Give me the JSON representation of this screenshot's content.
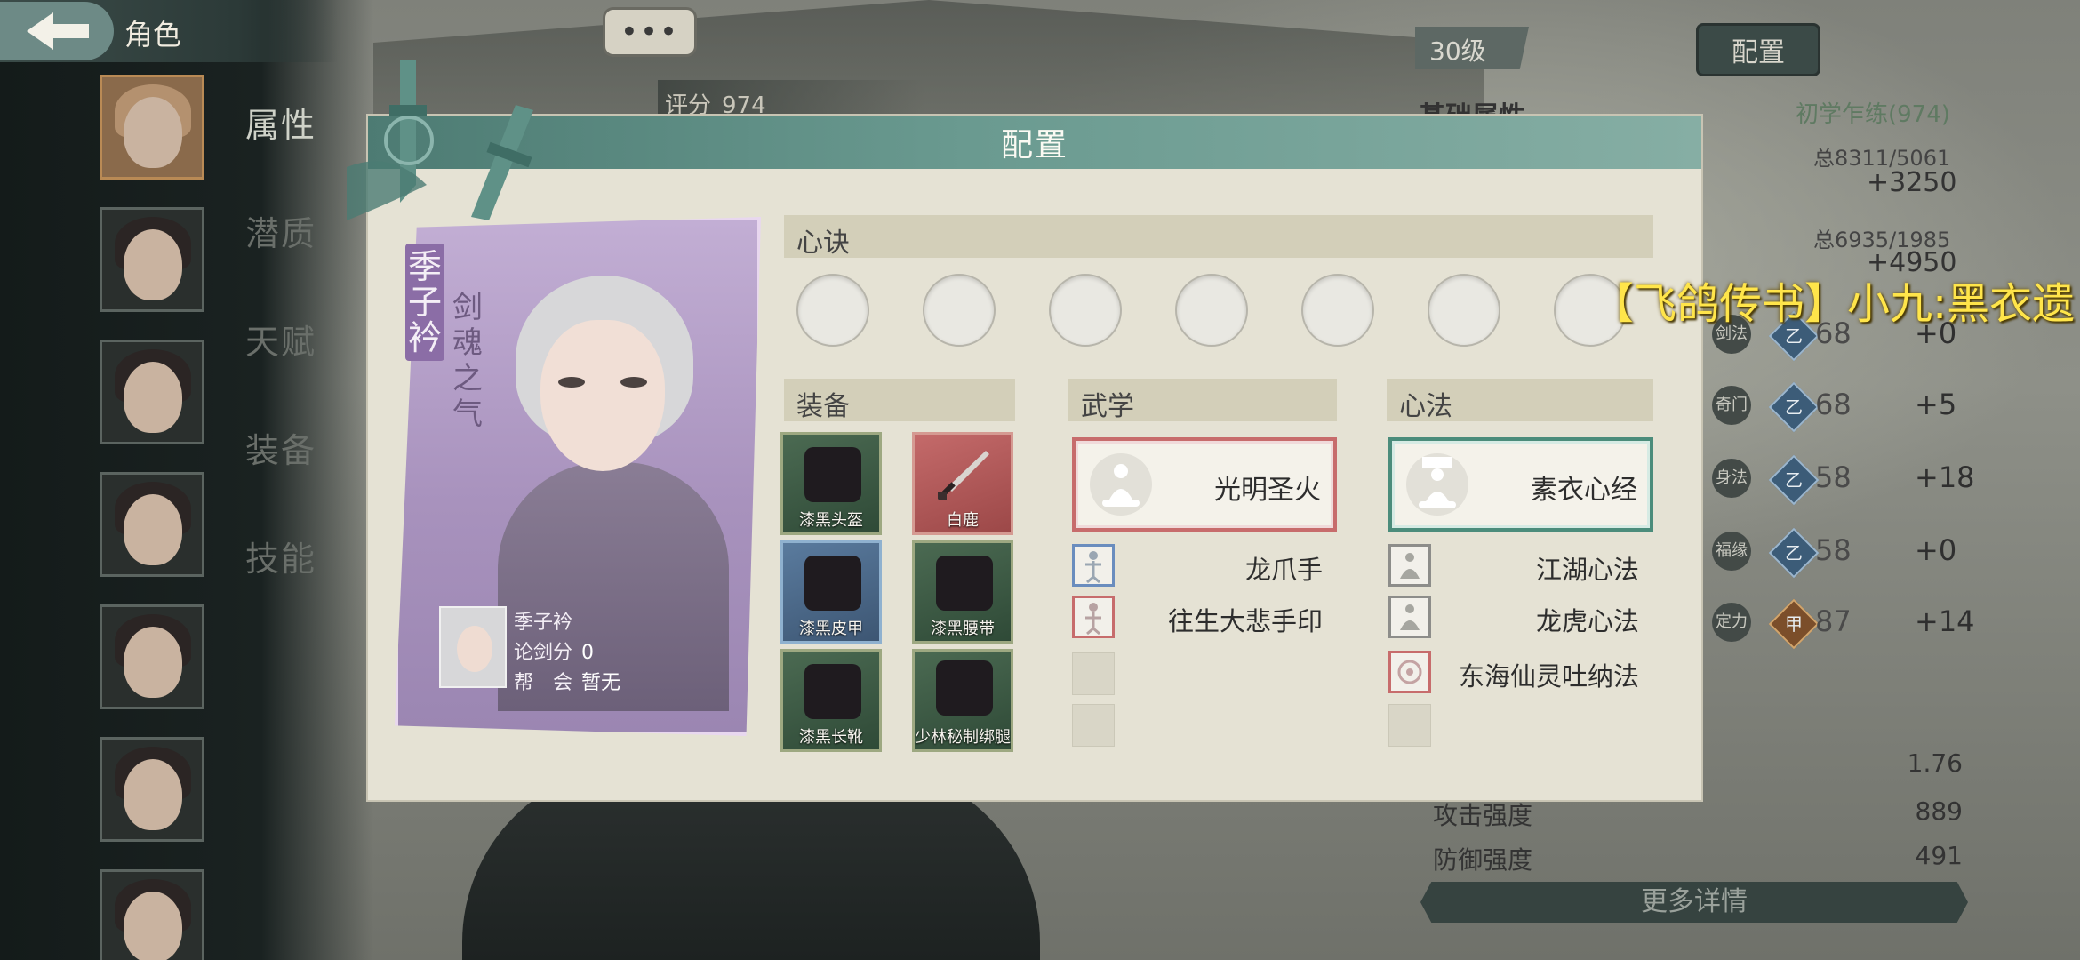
{
  "header": {
    "title": "角色",
    "chat_dots": "•••"
  },
  "score": {
    "label": "评分",
    "value": "974"
  },
  "nav": [
    {
      "label": "属性",
      "active": true
    },
    {
      "label": "潜质",
      "active": false
    },
    {
      "label": "天赋",
      "active": false
    },
    {
      "label": "装备",
      "active": false
    },
    {
      "label": "技能",
      "active": false
    }
  ],
  "right_panel": {
    "level": "30级",
    "config_button": "配置",
    "heading": "基础属性",
    "rank": "初学乍练(974)",
    "totals": [
      {
        "text": "总8311/5061",
        "delta": "+3250"
      },
      {
        "text": "总6935/1985",
        "delta": "+4950"
      }
    ],
    "attributes": [
      {
        "icon": "剑法",
        "gem": "乙",
        "value": "68",
        "plus": "+0"
      },
      {
        "icon": "奇门",
        "gem": "乙",
        "value": "68",
        "plus": "+5"
      },
      {
        "icon": "身法",
        "gem": "乙",
        "value": "58",
        "plus": "+18"
      },
      {
        "icon": "福缘",
        "gem": "乙",
        "value": "58",
        "plus": "+0"
      },
      {
        "icon": "定力",
        "gem": "甲",
        "value": "87",
        "plus": "+14"
      }
    ],
    "bottom_stats": [
      {
        "label": "",
        "value": "1.76"
      },
      {
        "label": "攻击强度",
        "value": "889"
      },
      {
        "label": "防御强度",
        "value": "491"
      }
    ],
    "more_details": "更多详情"
  },
  "modal": {
    "title": "配置",
    "character": {
      "name": "季子衿",
      "title": "剑魂之气",
      "info_name": "季子衿",
      "duel_label": "论剑分",
      "duel_value": "0",
      "guild_label": "帮　会",
      "guild_value": "暂无"
    },
    "xinjue": {
      "heading": "心诀",
      "slots": 7
    },
    "equipment": {
      "heading": "装备",
      "items": [
        {
          "name": "漆黑头盔",
          "rarity": "green"
        },
        {
          "name": "白鹿",
          "rarity": "red"
        },
        {
          "name": "漆黑皮甲",
          "rarity": "blue"
        },
        {
          "name": "漆黑腰带",
          "rarity": "green"
        },
        {
          "name": "漆黑长靴",
          "rarity": "green"
        },
        {
          "name": "少林秘制绑腿",
          "rarity": "green"
        }
      ]
    },
    "martial": {
      "heading": "武学",
      "main": "光明圣火",
      "list": [
        "龙爪手",
        "往生大悲手印"
      ]
    },
    "heart_method": {
      "heading": "心法",
      "main": "素衣心经",
      "list": [
        "江湖心法",
        "龙虎心法",
        "东海仙灵吐纳法"
      ]
    }
  },
  "ticker": "【飞鸽传书】小九:黑衣遗",
  "colors": {
    "modal_header": "#5f8f86",
    "ticker": "#ffe54a",
    "accent_red": "#c76c6c",
    "accent_teal": "#4b8c7b"
  }
}
